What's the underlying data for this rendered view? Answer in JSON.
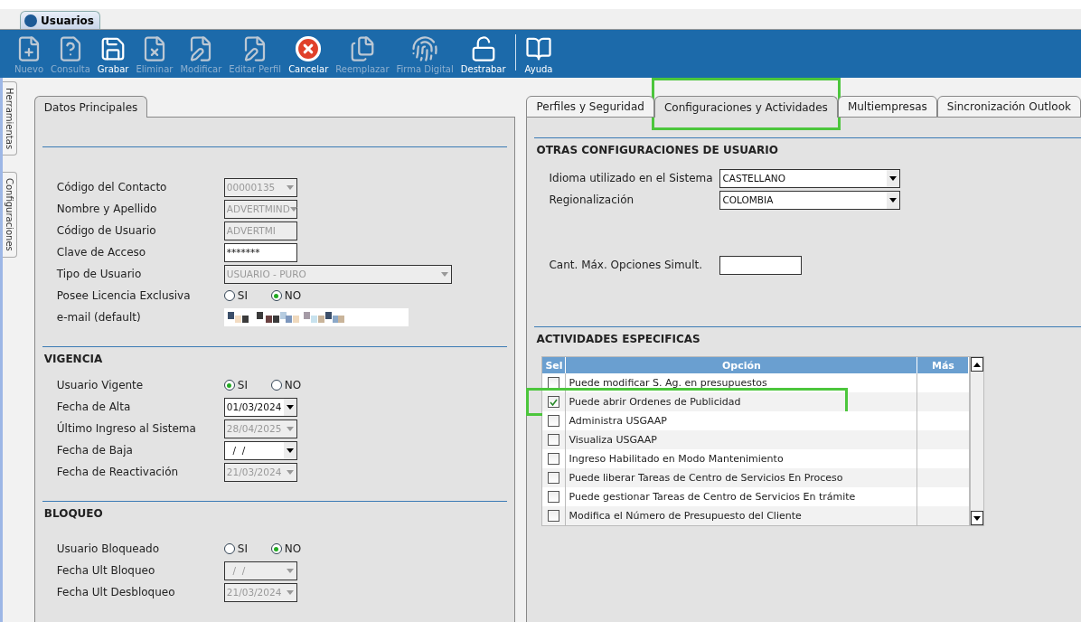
{
  "window": {
    "tab": "Usuarios"
  },
  "toolbar": [
    {
      "label": "Nuevo",
      "enabled": false
    },
    {
      "label": "Consulta",
      "enabled": false
    },
    {
      "label": "Grabar",
      "enabled": true
    },
    {
      "label": "Eliminar",
      "enabled": false
    },
    {
      "label": "Modificar",
      "enabled": false
    },
    {
      "label": "Editar Perfil",
      "enabled": false
    },
    {
      "label": "Cancelar",
      "enabled": true
    },
    {
      "label": "Reemplazar",
      "enabled": false
    },
    {
      "label": "Firma Digital",
      "enabled": false
    },
    {
      "label": "Destrabar",
      "enabled": true
    },
    {
      "label": "Ayuda",
      "enabled": true
    }
  ],
  "side_tabs": [
    "Herramientas",
    "Configuraciones"
  ],
  "left_panel": {
    "tab": "Datos Principales",
    "sections": [
      {
        "rows": [
          {
            "label": "Código del Contacto",
            "kind": "select",
            "value": "00000135",
            "disabled": true
          },
          {
            "label": "Nombre y Apellido",
            "kind": "select",
            "value": "ADVERTMIND",
            "disabled": true
          },
          {
            "label": "Código de Usuario",
            "kind": "input",
            "value": "ADVERTMI",
            "disabled": true
          },
          {
            "label": "Clave de Acceso",
            "kind": "input",
            "value": "*******",
            "disabled": false
          },
          {
            "label": "Tipo de Usuario",
            "kind": "select",
            "value": "USUARIO - PURO",
            "disabled": true
          },
          {
            "label": "Posee Licencia Exclusiva",
            "kind": "radio",
            "options": [
              {
                "label": "SI",
                "selected": false
              },
              {
                "label": "NO",
                "selected": true
              }
            ]
          },
          {
            "label": "e-mail (default)",
            "kind": "redacted"
          }
        ]
      },
      {
        "title": "VIGENCIA",
        "rows": [
          {
            "label": "Usuario Vigente",
            "kind": "radio",
            "options": [
              {
                "label": "SI",
                "selected": true
              },
              {
                "label": "NO",
                "selected": false
              }
            ]
          },
          {
            "label": "Fecha de Alta",
            "kind": "select",
            "value": "01/03/2024",
            "disabled": false
          },
          {
            "label": "Último Ingreso al Sistema",
            "kind": "select",
            "value": "28/04/2025",
            "disabled": true
          },
          {
            "label": "Fecha de Baja",
            "kind": "select",
            "value": "  /  /",
            "disabled": false
          },
          {
            "label": "Fecha de Reactivación",
            "kind": "select",
            "value": "21/03/2024",
            "disabled": true
          }
        ]
      },
      {
        "title": "BLOQUEO",
        "rows": [
          {
            "label": "Usuario Bloqueado",
            "kind": "radio",
            "options": [
              {
                "label": "SI",
                "selected": false
              },
              {
                "label": "NO",
                "selected": true
              }
            ]
          },
          {
            "label": "Fecha Ult Bloqueo",
            "kind": "select",
            "value": "  /  /",
            "disabled": true
          },
          {
            "label": "Fecha Ult Desbloqueo",
            "kind": "select",
            "value": "21/03/2024",
            "disabled": true
          }
        ]
      }
    ]
  },
  "right_panel": {
    "tabs": [
      {
        "label": "Perfiles y Seguridad",
        "selected": false,
        "highlighted": false
      },
      {
        "label": "Configuraciones y Actividades",
        "selected": true,
        "highlighted": true
      },
      {
        "label": "Multiempresas",
        "selected": false,
        "highlighted": false
      },
      {
        "label": "Sincronización Outlook",
        "selected": false,
        "highlighted": false
      }
    ],
    "config_title": "OTRAS CONFIGURACIONES DE USUARIO",
    "config_rows": [
      {
        "label": "Idioma utilizado en el Sistema",
        "value": "CASTELLANO"
      },
      {
        "label": "Regionalización",
        "value": "COLOMBIA"
      }
    ],
    "max_options": {
      "label": "Cant. Máx. Opciones Simult."
    },
    "activities_title": "ACTIVIDADES ESPECIFICAS",
    "table": {
      "columns": [
        "Sel",
        "Opción",
        "Más"
      ],
      "rows": [
        {
          "option": "Puede modificar S. Ag. en presupuestos",
          "checked": false,
          "highlighted": false
        },
        {
          "option": "Puede abrir Ordenes de Publicidad",
          "checked": true,
          "highlighted": true
        },
        {
          "option": "Administra USGAAP",
          "checked": false,
          "highlighted": false
        },
        {
          "option": "Visualiza USGAAP",
          "checked": false,
          "highlighted": false
        },
        {
          "option": "Ingreso Habilitado en Modo Mantenimiento",
          "checked": false,
          "highlighted": false
        },
        {
          "option": "Puede liberar Tareas de Centro de Servicios En Proceso",
          "checked": false,
          "highlighted": false
        },
        {
          "option": "Puede gestionar Tareas de Centro de Servicios En trámite",
          "checked": false,
          "highlighted": false
        },
        {
          "option": "Modifica el Número de Presupuesto del Cliente",
          "checked": false,
          "highlighted": false
        }
      ]
    }
  }
}
